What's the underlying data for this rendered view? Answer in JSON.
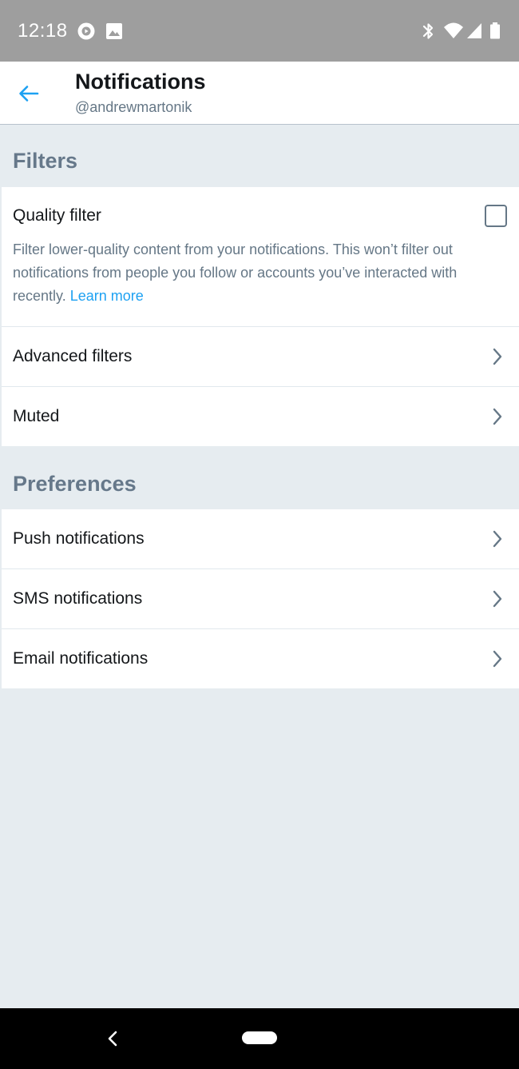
{
  "status_bar": {
    "time": "12:18",
    "left_icons": [
      "play-circle-icon",
      "image-icon"
    ],
    "right_icons": [
      "bluetooth-icon",
      "wifi-icon",
      "cell-signal-icon",
      "battery-icon"
    ]
  },
  "header": {
    "title": "Notifications",
    "handle": "@andrewmartonik",
    "back_icon": "arrow-left-icon"
  },
  "filters": {
    "section_title": "Filters",
    "quality_filter": {
      "label": "Quality filter",
      "checked": false,
      "description": "Filter lower-quality content from your notifications. This won’t filter out notifications from people you follow or accounts you’ve interacted with recently.",
      "link": "Learn more"
    },
    "items": [
      {
        "label": "Advanced filters"
      },
      {
        "label": "Muted"
      }
    ]
  },
  "preferences": {
    "section_title": "Preferences",
    "items": [
      {
        "label": "Push notifications"
      },
      {
        "label": "SMS notifications"
      },
      {
        "label": "Email notifications"
      }
    ]
  },
  "colors": {
    "accent": "#1da1f2",
    "background": "#e6ecf0",
    "section_title": "#66788a",
    "text_primary": "#14171a",
    "text_secondary": "#657786",
    "status_bar": "#9e9e9e"
  }
}
